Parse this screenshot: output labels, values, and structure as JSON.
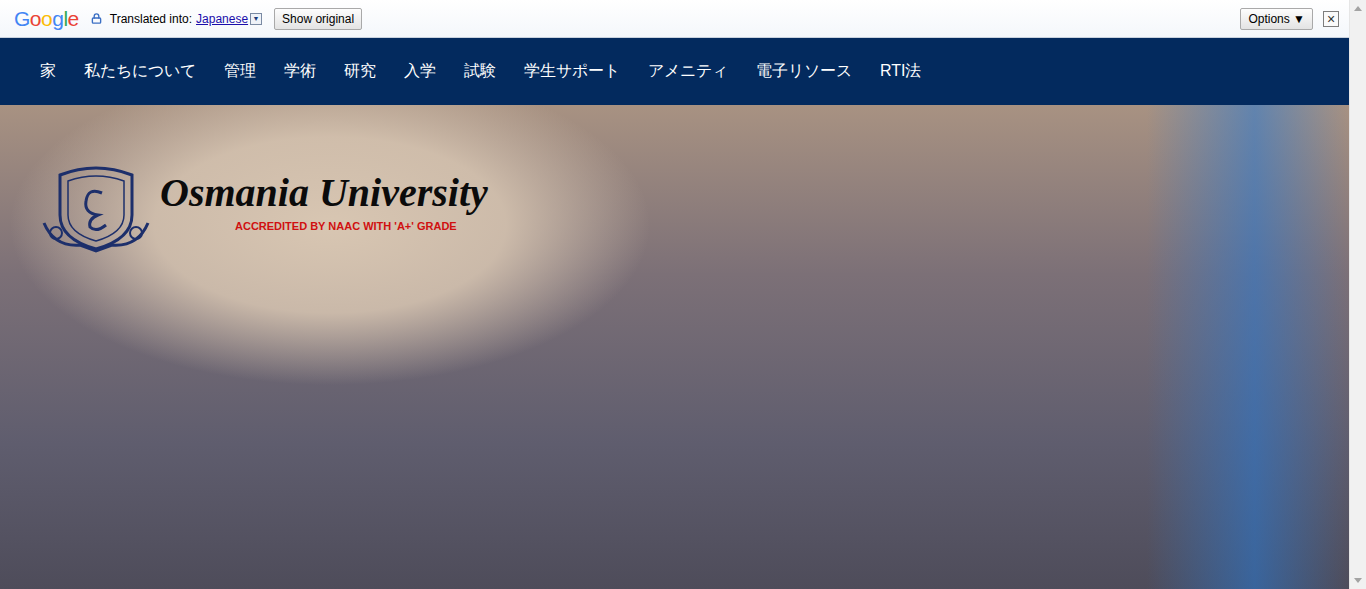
{
  "translate_bar": {
    "brand": "Google",
    "label": "Translated into:",
    "language": "Japanese",
    "dropdown_icon": "▼",
    "show_original": "Show original",
    "options": "Options ▼",
    "close": "×"
  },
  "nav": {
    "items": [
      {
        "label": "家"
      },
      {
        "label": "私たちについて"
      },
      {
        "label": "管理"
      },
      {
        "label": "学術"
      },
      {
        "label": "研究"
      },
      {
        "label": "入学"
      },
      {
        "label": "試験"
      },
      {
        "label": "学生サポート"
      },
      {
        "label": "アメニティ"
      },
      {
        "label": "電子リソース"
      },
      {
        "label": "RTI法"
      }
    ]
  },
  "hero": {
    "title": "Osmania University",
    "subtitle": "ACCREDITED BY NAAC WITH 'A+' GRADE"
  }
}
